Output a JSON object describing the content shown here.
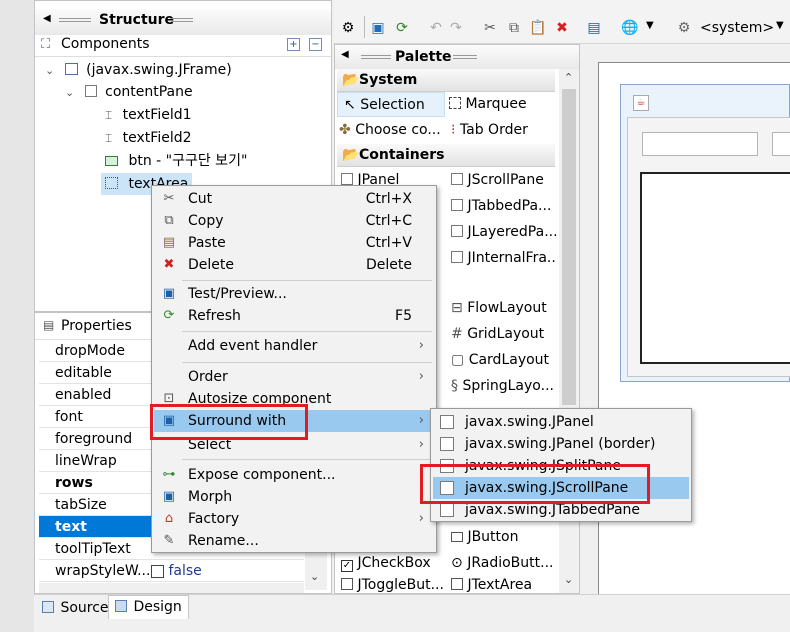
{
  "structure": {
    "title": "Structure",
    "components_label": "Components",
    "tree": [
      {
        "label": "(javax.swing.JFrame)"
      },
      {
        "label": "contentPane"
      },
      {
        "label": "textField1"
      },
      {
        "label": "textField2"
      },
      {
        "label": "btn - \"구구단 보기\""
      },
      {
        "label": "textArea"
      }
    ]
  },
  "properties": {
    "title": "Properties",
    "rows": [
      {
        "name": "dropMode",
        "value": ""
      },
      {
        "name": "editable",
        "value": ""
      },
      {
        "name": "enabled",
        "value": ""
      },
      {
        "name": "font",
        "value": ""
      },
      {
        "name": "foreground",
        "value": ""
      },
      {
        "name": "lineWrap",
        "value": ""
      },
      {
        "name": "rows",
        "value": ""
      },
      {
        "name": "tabSize",
        "value": ""
      },
      {
        "name": "text",
        "value": ""
      },
      {
        "name": "toolTipText",
        "value": ""
      },
      {
        "name": "wrapStyleW...",
        "value": "false"
      }
    ]
  },
  "bottom_tabs": {
    "source": "Source",
    "design": "Design"
  },
  "toolbar": {
    "system_combo": "<system>"
  },
  "palette": {
    "title": "Palette",
    "system_cat": "System",
    "selection": "Selection",
    "marquee": "Marquee",
    "choose": "Choose co...",
    "tab_order": "Tab Order",
    "containers_cat": "Containers",
    "jpanel": "JPanel",
    "jscrollpane": "JScrollPane",
    "jtabbedpane": "JTabbedPa...",
    "jlayeredpane": "JLayeredPa...",
    "jinternalframe": "JInternalFra...",
    "flowlayout": "FlowLayout",
    "gridlayout": "GridLayout",
    "cardlayout": "CardLayout",
    "springlayout": "SpringLayo...",
    "jbutton": "JButton",
    "jcheckbox": "JCheckBox",
    "jradiobutton": "JRadioButt...",
    "jtogglebutton": "JToggleBut...",
    "jtextarea": "JTextArea"
  },
  "context_menu": {
    "cut": "Cut",
    "cut_key": "Ctrl+X",
    "copy": "Copy",
    "copy_key": "Ctrl+C",
    "paste": "Paste",
    "paste_key": "Ctrl+V",
    "delete": "Delete",
    "delete_key": "Delete",
    "test_preview": "Test/Preview...",
    "refresh": "Refresh",
    "refresh_key": "F5",
    "add_event_handler": "Add event handler",
    "order": "Order",
    "autosize": "Autosize component",
    "surround_with": "Surround with",
    "select": "Select",
    "expose": "Expose component...",
    "morph": "Morph",
    "factory": "Factory",
    "rename": "Rename..."
  },
  "submenu": {
    "items": [
      "javax.swing.JPanel",
      "javax.swing.JPanel (border)",
      "javax.swing.JSplitPane",
      "javax.swing.JScrollPane",
      "javax.swing.JTabbedPane"
    ]
  },
  "colors": {
    "highlight": "#99c9ef",
    "selected_row": "#0078d7",
    "annotation": "#e31b23"
  }
}
